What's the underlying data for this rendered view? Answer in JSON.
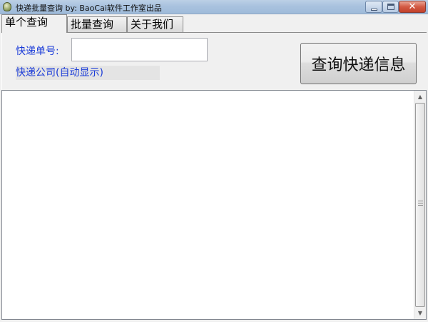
{
  "window": {
    "title": "快递批量查询   by: BaoCai软件工作室出品",
    "controls": {
      "minimize": "minimize-icon",
      "maximize": "maximize-icon",
      "close": "✕"
    }
  },
  "tabs": [
    {
      "label": "单个查询",
      "active": true
    },
    {
      "label": "批量查询",
      "active": false
    },
    {
      "label": "关于我们",
      "active": false
    }
  ],
  "form": {
    "number_label": "快递单号:",
    "number_value": "",
    "company_label": "快递公司(自动显示)",
    "query_button": "查询快递信息"
  },
  "result": {
    "text": ""
  },
  "colors": {
    "label_blue": "#1a3bd8",
    "close_red": "#c2412b"
  }
}
